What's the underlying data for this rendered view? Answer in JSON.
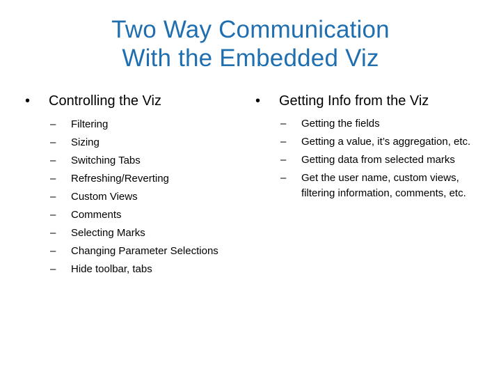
{
  "slide": {
    "title_line1": "Two Way Communication",
    "title_line2": "With the Embedded Viz",
    "title_color": "#1f6fb0",
    "bullet_glyph": "•",
    "dash_glyph": "–",
    "left": {
      "heading": "Controlling the Viz",
      "items": [
        "Filtering",
        "Sizing",
        "Switching Tabs",
        "Refreshing/Reverting",
        "Custom Views",
        "Comments",
        "Selecting Marks",
        "Changing Parameter Selections",
        "Hide toolbar, tabs"
      ]
    },
    "right": {
      "heading": "Getting Info from the Viz",
      "items": [
        "Getting the fields",
        "Getting a value, it’s aggregation, etc.",
        "Getting data from selected marks",
        "Get the user name, custom views, filtering information, comments, etc."
      ]
    }
  }
}
